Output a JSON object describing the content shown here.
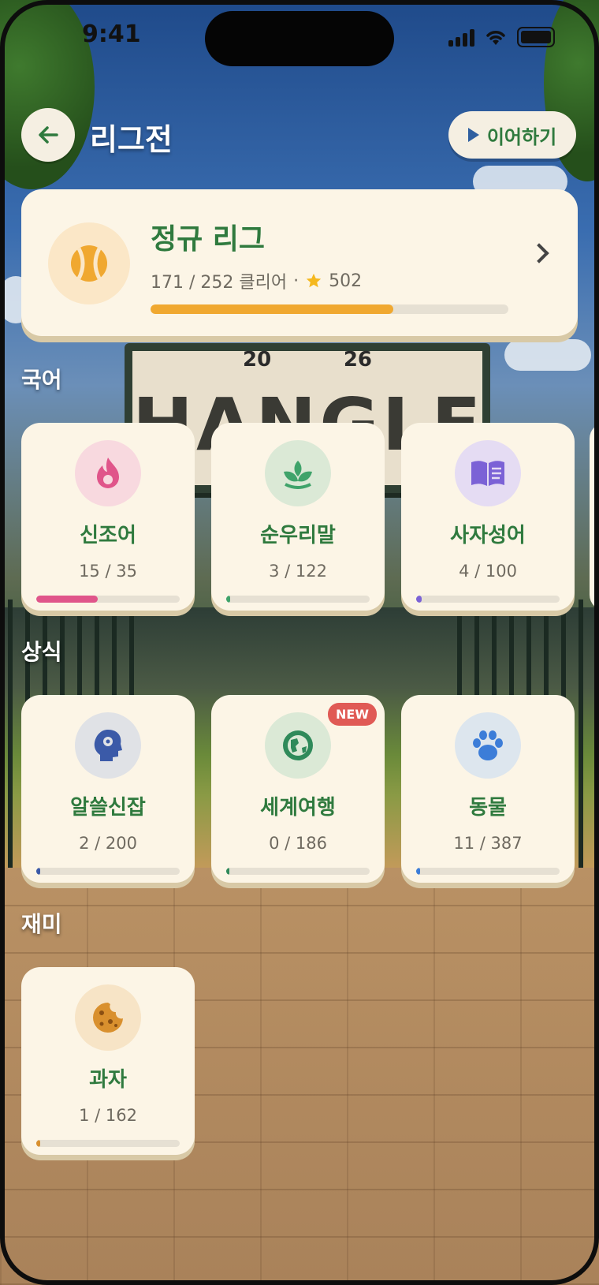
{
  "status_bar": {
    "time": "9:41"
  },
  "header": {
    "title": "리그전",
    "resume_label": "이어하기"
  },
  "scenery": {
    "sign_text": "HANGLE",
    "sign_year_left": "20",
    "sign_year_right": "26"
  },
  "league": {
    "title": "정규 리그",
    "progress_text": "171 / 252 클리어",
    "separator": "·",
    "stars": "502",
    "progress": 0.679,
    "accent": "#f0a830"
  },
  "sections": [
    {
      "title": "국어",
      "cards": [
        {
          "name": "신조어",
          "count": "15 / 35",
          "progress": 0.4286,
          "color": "#e0558a",
          "bg": "#f8d9df",
          "icon": "flame-icon"
        },
        {
          "name": "순우리말",
          "count": "3 / 122",
          "progress": 0.025,
          "color": "#3fa36a",
          "bg": "#dbe9d6",
          "icon": "sprout-icon"
        },
        {
          "name": "사자성어",
          "count": "4 / 100",
          "progress": 0.04,
          "color": "#7b62d6",
          "bg": "#e5dcf3",
          "icon": "book-icon"
        }
      ]
    },
    {
      "title": "상식",
      "cards": [
        {
          "name": "알쓸신잡",
          "count": "2 / 200",
          "progress": 0.01,
          "color": "#3b5aa8",
          "bg": "#e0e2e6",
          "icon": "brain-gear-icon"
        },
        {
          "name": "세계여행",
          "count": "0 / 186",
          "progress": 0.0,
          "color": "#2f8a5a",
          "bg": "#dbe9d6",
          "icon": "globe-icon",
          "badge": "NEW"
        },
        {
          "name": "동물",
          "count": "11 / 387",
          "progress": 0.028,
          "color": "#3c7dd8",
          "bg": "#dde6ee",
          "icon": "paw-icon"
        }
      ]
    },
    {
      "title": "재미",
      "cards": [
        {
          "name": "과자",
          "count": "1 / 162",
          "progress": 0.006,
          "color": "#d9902e",
          "bg": "#f7e4c6",
          "icon": "cookie-icon"
        }
      ]
    }
  ]
}
